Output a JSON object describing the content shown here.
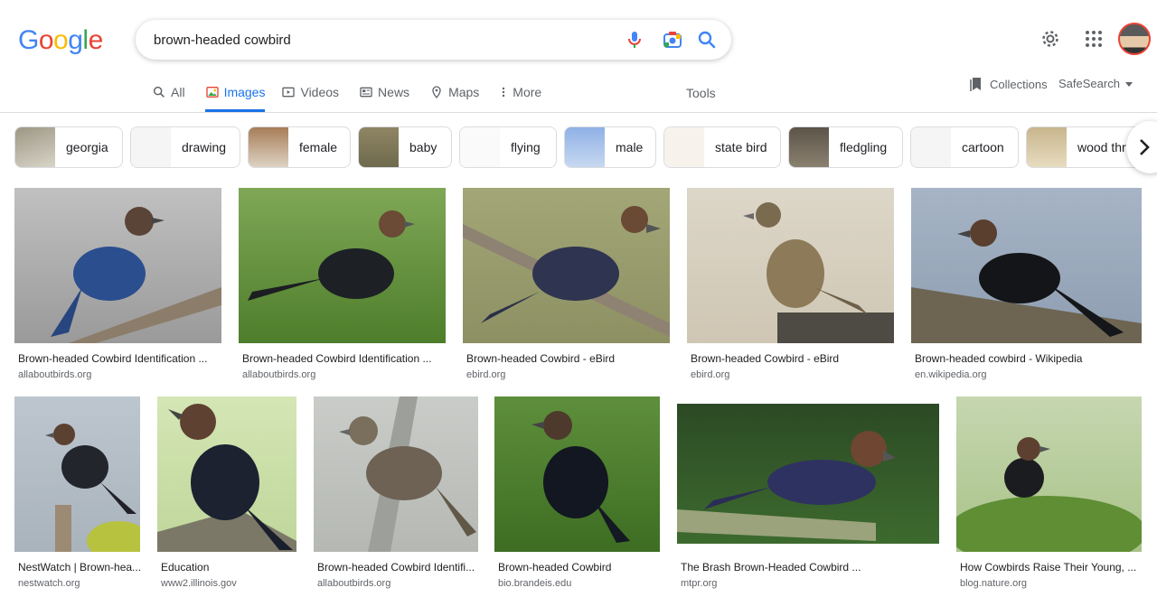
{
  "logo": "Google",
  "search": {
    "query": "brown-headed cowbird"
  },
  "tabs": [
    {
      "label": "All"
    },
    {
      "label": "Images"
    },
    {
      "label": "Videos"
    },
    {
      "label": "News"
    },
    {
      "label": "Maps"
    },
    {
      "label": "More"
    }
  ],
  "tools_label": "Tools",
  "collections_label": "Collections",
  "safesearch_label": "SafeSearch",
  "chips": [
    {
      "label": "georgia"
    },
    {
      "label": "drawing"
    },
    {
      "label": "female"
    },
    {
      "label": "baby"
    },
    {
      "label": "flying"
    },
    {
      "label": "male"
    },
    {
      "label": "state bird"
    },
    {
      "label": "fledgling"
    },
    {
      "label": "cartoon"
    },
    {
      "label": "wood thr"
    }
  ],
  "results": [
    {
      "caption": "Brown-headed Cowbird Identification ...",
      "source": "allaboutbirds.org"
    },
    {
      "caption": "Brown-headed Cowbird Identification ...",
      "source": "allaboutbirds.org"
    },
    {
      "caption": "Brown-headed Cowbird - eBird",
      "source": "ebird.org"
    },
    {
      "caption": "Brown-headed Cowbird - eBird",
      "source": "ebird.org"
    },
    {
      "caption": "Brown-headed cowbird - Wikipedia",
      "source": "en.wikipedia.org"
    },
    {
      "caption": "NestWatch | Brown-hea...",
      "source": "nestwatch.org"
    },
    {
      "caption": "Education",
      "source": "www2.illinois.gov"
    },
    {
      "caption": "Brown-headed Cowbird Identifi...",
      "source": "allaboutbirds.org"
    },
    {
      "caption": "Brown-headed Cowbird",
      "source": "bio.brandeis.edu"
    },
    {
      "caption": "The Brash Brown-Headed Cowbird ...",
      "source": "mtpr.org"
    },
    {
      "caption": "How Cowbirds Raise Their Young, ...",
      "source": "blog.nature.org"
    }
  ],
  "colors": {
    "accent": "#1a73e8",
    "google_blue": "#4285f4",
    "google_red": "#ea4335",
    "google_yellow": "#fbbc05",
    "google_green": "#34a853"
  }
}
